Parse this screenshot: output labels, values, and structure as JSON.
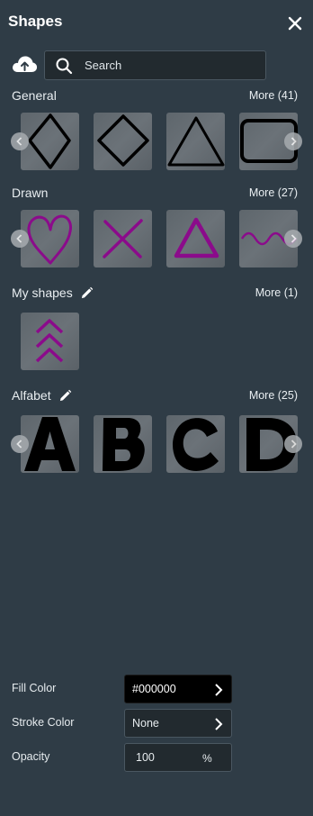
{
  "panel": {
    "title": "Shapes"
  },
  "search": {
    "placeholder": "Search",
    "value": ""
  },
  "sections": {
    "general": {
      "title": "General",
      "more": "More (41)"
    },
    "drawn": {
      "title": "Drawn",
      "more": "More (27)"
    },
    "my_shapes": {
      "title": "My shapes",
      "more": "More (1)"
    },
    "alfabet": {
      "title": "Alfabet",
      "more": "More (25)"
    }
  },
  "shapes": {
    "general": [
      "diamond-tall",
      "diamond",
      "triangle",
      "rounded-rectangle"
    ],
    "drawn": [
      "heart",
      "cross",
      "triangle",
      "wave"
    ],
    "my_shapes": [
      "chevrons-up"
    ],
    "alfabet": [
      "A",
      "B",
      "C",
      "D"
    ]
  },
  "properties": {
    "fill_color": {
      "label": "Fill Color",
      "value": "#000000"
    },
    "stroke_color": {
      "label": "Stroke Color",
      "value": "None"
    },
    "opacity": {
      "label": "Opacity",
      "value": "100",
      "unit": "%"
    }
  },
  "colors": {
    "background": "#2f3c46",
    "drawn_stroke": "#8b0b8b",
    "shape_stroke": "#000000"
  }
}
